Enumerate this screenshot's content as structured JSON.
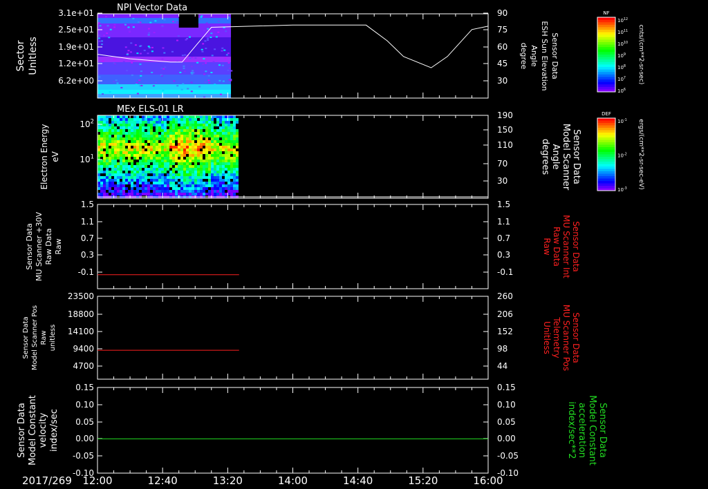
{
  "figure": {
    "date_label": "2017/269",
    "time_ticks": [
      "12:00",
      "12:40",
      "13:20",
      "14:00",
      "14:40",
      "15:20",
      "16:00"
    ]
  },
  "chart_data": [
    {
      "type": "heatmap",
      "title": "NPI Vector Data",
      "ylabel": [
        "Sector",
        "Unitless"
      ],
      "y_ticks": [
        "3.1e+01",
        "2.5e+01",
        "1.9e+01",
        "1.2e+01",
        "6.2e+00"
      ],
      "y2label": [
        "Sensor Data",
        "ESH Sun Elevation",
        "Angle",
        "degree"
      ],
      "y2_ticks": [
        "90",
        "75",
        "60",
        "45",
        "30"
      ],
      "y2lim": [
        15,
        90
      ],
      "data_end_time": "13:22",
      "colorbar": {
        "label": "NF",
        "units": "cnts/(cm**2-sr-sec)",
        "ticks": [
          "10^12",
          "10^11",
          "10^10",
          "10^9",
          "10^8",
          "10^7",
          "10^6"
        ]
      },
      "overlay_line": {
        "color": "#ffffff",
        "x": [
          "12:00",
          "12:20",
          "12:45",
          "12:52",
          "13:00",
          "13:10",
          "14:00",
          "14:45",
          "14:58",
          "15:08",
          "15:25",
          "15:35",
          "15:50",
          "16:00"
        ],
        "y": [
          54,
          50,
          47,
          47,
          61,
          78,
          80,
          80,
          66,
          52,
          42,
          52,
          76,
          79
        ]
      }
    },
    {
      "type": "heatmap",
      "title": "MEx ELS-01 LR",
      "ylabel": [
        "Electron Energy",
        "eV"
      ],
      "y_ticks": [
        "10^2",
        "10^1"
      ],
      "y2label": [
        "Sensor Data",
        "Model Scanner",
        "Angle",
        "degrees"
      ],
      "y2_ticks": [
        "190",
        "150",
        "110",
        "70",
        "30"
      ],
      "y2lim": [
        10,
        190
      ],
      "data_end_time": "13:25",
      "colorbar": {
        "label": "DEF",
        "units": "ergs/(cm**2-sr-sec-eV)",
        "ticks": [
          "10^-1",
          "10^-2",
          "10^-3"
        ]
      },
      "overlay_line": {
        "color": "#ffffff",
        "x": [
          "12:00",
          "16:00"
        ],
        "y": [
          13,
          13
        ]
      }
    },
    {
      "type": "line",
      "ylabel": [
        "Sensor Data",
        "MU Scanner +30V",
        "Raw Data",
        "Raw"
      ],
      "y_ticks": [
        "1.5",
        "1.1",
        "0.7",
        "0.3",
        "-0.1"
      ],
      "ylim": [
        -0.3,
        1.5
      ],
      "y2label": [
        "Sensor Data",
        "MU Scanner Int",
        "Raw Data",
        "Raw"
      ],
      "y2_ticks": [
        "1.5",
        "1.1",
        "0.7",
        "0.3",
        "-0.1"
      ],
      "series": [
        {
          "color": "#ff2020",
          "x": [
            "12:00",
            "13:27"
          ],
          "y": [
            0,
            0
          ]
        }
      ]
    },
    {
      "type": "line",
      "ylabel": [
        "Sensor Data",
        "Model Scanner Pos",
        "Raw",
        "unitless"
      ],
      "y_ticks": [
        "23500",
        "18800",
        "14100",
        "9400",
        "4700"
      ],
      "ylim": [
        0,
        23500
      ],
      "y2label": [
        "Sensor Data",
        "MU Scanner Pos",
        "Telemetry",
        "Unitless"
      ],
      "y2_ticks": [
        "260",
        "206",
        "152",
        "98",
        "44"
      ],
      "series": [
        {
          "color": "#ff2020",
          "x": [
            "12:00",
            "13:27"
          ],
          "y": [
            8200,
            8200
          ]
        }
      ]
    },
    {
      "type": "line",
      "ylabel": [
        "Sensor Data",
        "Model Constant",
        "velocity",
        "index/sec"
      ],
      "y_ticks": [
        "0.15",
        "0.10",
        "0.05",
        "0.00",
        "-0.05",
        "-0.10"
      ],
      "ylim": [
        -0.1,
        0.15
      ],
      "y2label": [
        "Sensor Data",
        "Model Constant",
        "acceleration",
        "index/sec**2"
      ],
      "y2_ticks": [
        "0.15",
        "0.10",
        "0.05",
        "0.00",
        "-0.05",
        "-0.10"
      ],
      "series": [
        {
          "color": "#22dd22",
          "x": [
            "12:00",
            "16:00"
          ],
          "y": [
            0,
            0
          ]
        }
      ]
    }
  ],
  "colors": {
    "axis": "#ffffff",
    "right_label_red": "#ff2020",
    "right_label_green": "#22dd22",
    "background": "#000000"
  }
}
